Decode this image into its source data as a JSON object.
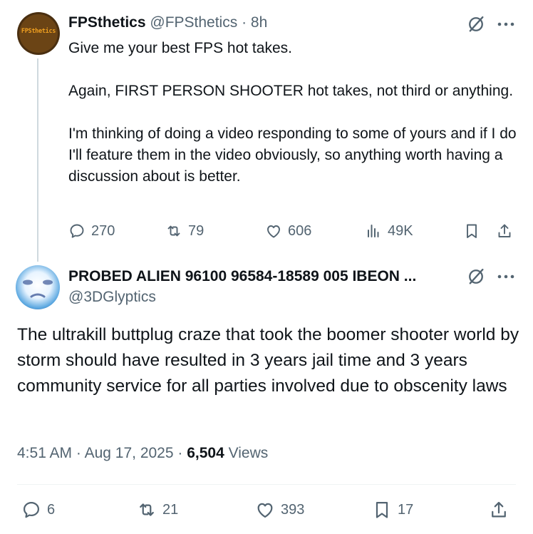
{
  "parent": {
    "avatar_text": "FPSthetics",
    "name": "FPSthetics",
    "handle": "@FPSthetics",
    "separator": "·",
    "time": "8h",
    "body": [
      "Give me your best FPS hot takes.",
      "Again, FIRST PERSON SHOOTER hot takes, not third or anything.",
      "I'm thinking of doing a video responding to some of yours and if I do I'll feature them in the video obviously, so anything worth having a discussion about is better."
    ],
    "replies": "270",
    "reposts": "79",
    "likes": "606",
    "views": "49K"
  },
  "main": {
    "name": "PROBED ALIEN 96100 96584-18589 005 IBEON ...",
    "handle": "@3DGlyptics",
    "body": "The ultrakill buttplug craze that took the boomer shooter world by storm should have resulted in 3 years jail time and 3 years community service for all parties involved due to obscenity laws",
    "time": "4:51 AM",
    "sep1": "·",
    "date": "Aug 17, 2025",
    "sep2": "·",
    "views_count": "6,504",
    "views_label": "Views",
    "replies": "6",
    "reposts": "21",
    "likes": "393",
    "bookmarks": "17"
  },
  "icons": {
    "reply": "reply-icon",
    "repost": "repost-icon",
    "like": "heart-icon",
    "views": "views-icon",
    "bookmark": "bookmark-icon",
    "share": "share-icon",
    "grok": "grok-icon",
    "more": "more-icon"
  },
  "colors": {
    "text": "#0f1419",
    "muted": "#536471",
    "thread_line": "#cfd9de",
    "divider": "#eff3f4"
  }
}
